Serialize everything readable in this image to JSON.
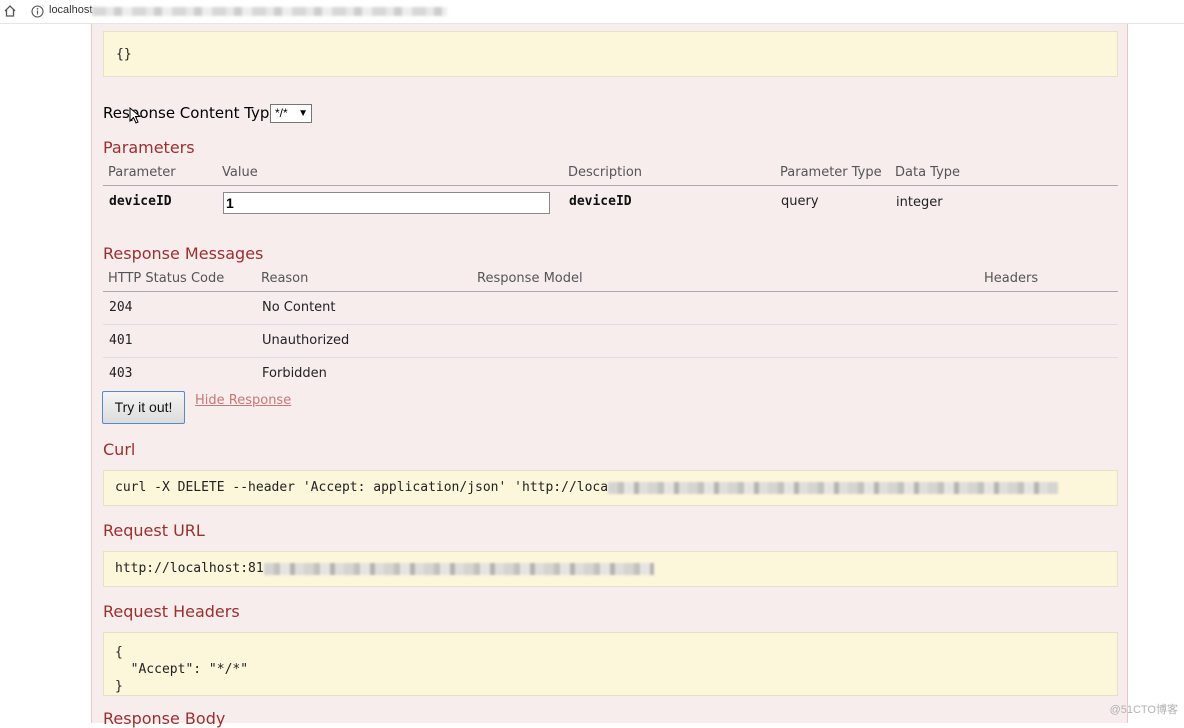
{
  "browser": {
    "url_visible": "localhost"
  },
  "body_param": {
    "value": "{}"
  },
  "response_content_type": {
    "label": "Response Content Type",
    "selected": "*/*"
  },
  "parameters": {
    "heading": "Parameters",
    "columns": [
      "Parameter",
      "Value",
      "Description",
      "Parameter Type",
      "Data Type"
    ],
    "rows": [
      {
        "parameter": "deviceID",
        "value": "1",
        "description": "deviceID",
        "parameter_type": "query",
        "data_type": "integer"
      }
    ]
  },
  "response_messages": {
    "heading": "Response Messages",
    "columns": [
      "HTTP Status Code",
      "Reason",
      "Response Model",
      "Headers"
    ],
    "rows": [
      {
        "code": "204",
        "reason": "No Content"
      },
      {
        "code": "401",
        "reason": "Unauthorized"
      },
      {
        "code": "403",
        "reason": "Forbidden"
      }
    ]
  },
  "actions": {
    "try_label": "Try it out!",
    "hide_label": "Hide Response"
  },
  "curl": {
    "heading": "Curl",
    "command_visible": "curl -X DELETE --header 'Accept: application/json' 'http://loca"
  },
  "request_url": {
    "heading": "Request URL",
    "url_visible": "http://localhost:81"
  },
  "request_headers": {
    "heading": "Request Headers",
    "lines": [
      "{",
      "  \"Accept\": \"*/*\"",
      "}"
    ]
  },
  "response_body": {
    "heading": "Response Body"
  },
  "watermark": "@51CTO博客",
  "colors": {
    "heading": "#993030",
    "panel_bg": "#f7eded",
    "code_bg": "#fcf6db",
    "link": "#c5787a"
  }
}
